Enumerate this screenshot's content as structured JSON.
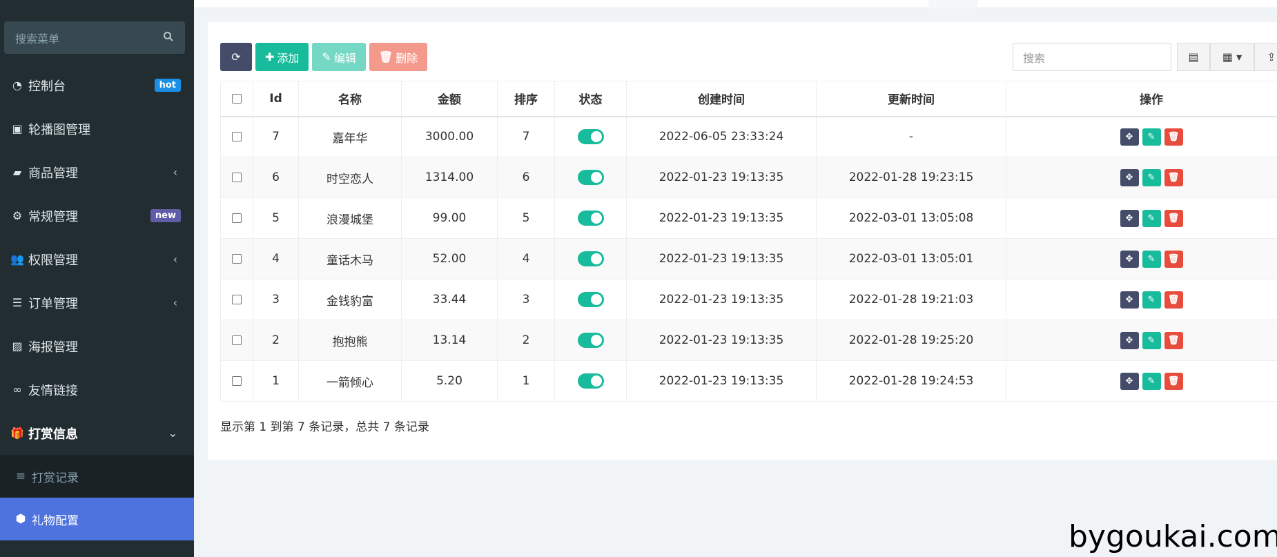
{
  "sidebar": {
    "search_placeholder": "搜索菜单",
    "items": [
      {
        "label": "控制台",
        "badge": "hot"
      },
      {
        "label": "轮播图管理"
      },
      {
        "label": "商品管理",
        "arrow": "‹"
      },
      {
        "label": "常规管理",
        "badge": "new"
      },
      {
        "label": "权限管理",
        "arrow": "‹"
      },
      {
        "label": "订单管理",
        "arrow": "‹"
      },
      {
        "label": "海报管理"
      },
      {
        "label": "友情链接"
      },
      {
        "label": "打赏信息",
        "arrow": "⌄"
      }
    ],
    "subitems": [
      {
        "label": "打赏记录"
      },
      {
        "label": "礼物配置"
      }
    ]
  },
  "toolbar": {
    "add_label": "添加",
    "edit_label": "编辑",
    "delete_label": "删除",
    "search_placeholder": "搜索"
  },
  "table": {
    "headers": [
      "Id",
      "名称",
      "金额",
      "排序",
      "状态",
      "创建时间",
      "更新时间",
      "操作"
    ],
    "rows": [
      {
        "id": "7",
        "name": "嘉年华",
        "amount": "3000.00",
        "sort": "7",
        "created": "2022-06-05 23:33:24",
        "updated": "-"
      },
      {
        "id": "6",
        "name": "时空恋人",
        "amount": "1314.00",
        "sort": "6",
        "created": "2022-01-23 19:13:35",
        "updated": "2022-01-28 19:23:15"
      },
      {
        "id": "5",
        "name": "浪漫城堡",
        "amount": "99.00",
        "sort": "5",
        "created": "2022-01-23 19:13:35",
        "updated": "2022-03-01 13:05:08"
      },
      {
        "id": "4",
        "name": "童话木马",
        "amount": "52.00",
        "sort": "4",
        "created": "2022-01-23 19:13:35",
        "updated": "2022-03-01 13:05:01"
      },
      {
        "id": "3",
        "name": "金钱豹富",
        "amount": "33.44",
        "sort": "3",
        "created": "2022-01-23 19:13:35",
        "updated": "2022-01-28 19:21:03"
      },
      {
        "id": "2",
        "name": "抱抱熊",
        "amount": "13.14",
        "sort": "2",
        "created": "2022-01-23 19:13:35",
        "updated": "2022-01-28 19:25:20"
      },
      {
        "id": "1",
        "name": "一箭倾心",
        "amount": "5.20",
        "sort": "1",
        "created": "2022-01-23 19:13:35",
        "updated": "2022-01-28 19:24:53"
      }
    ]
  },
  "summary": "显示第 1 到第 7 条记录，总共 7 条记录",
  "watermark": "bygoukai.com",
  "colors": {
    "sidebar_bg": "#222d32",
    "active": "#4e73df",
    "success": "#18bc9c",
    "danger": "#e74c3c",
    "dark": "#444c69"
  }
}
